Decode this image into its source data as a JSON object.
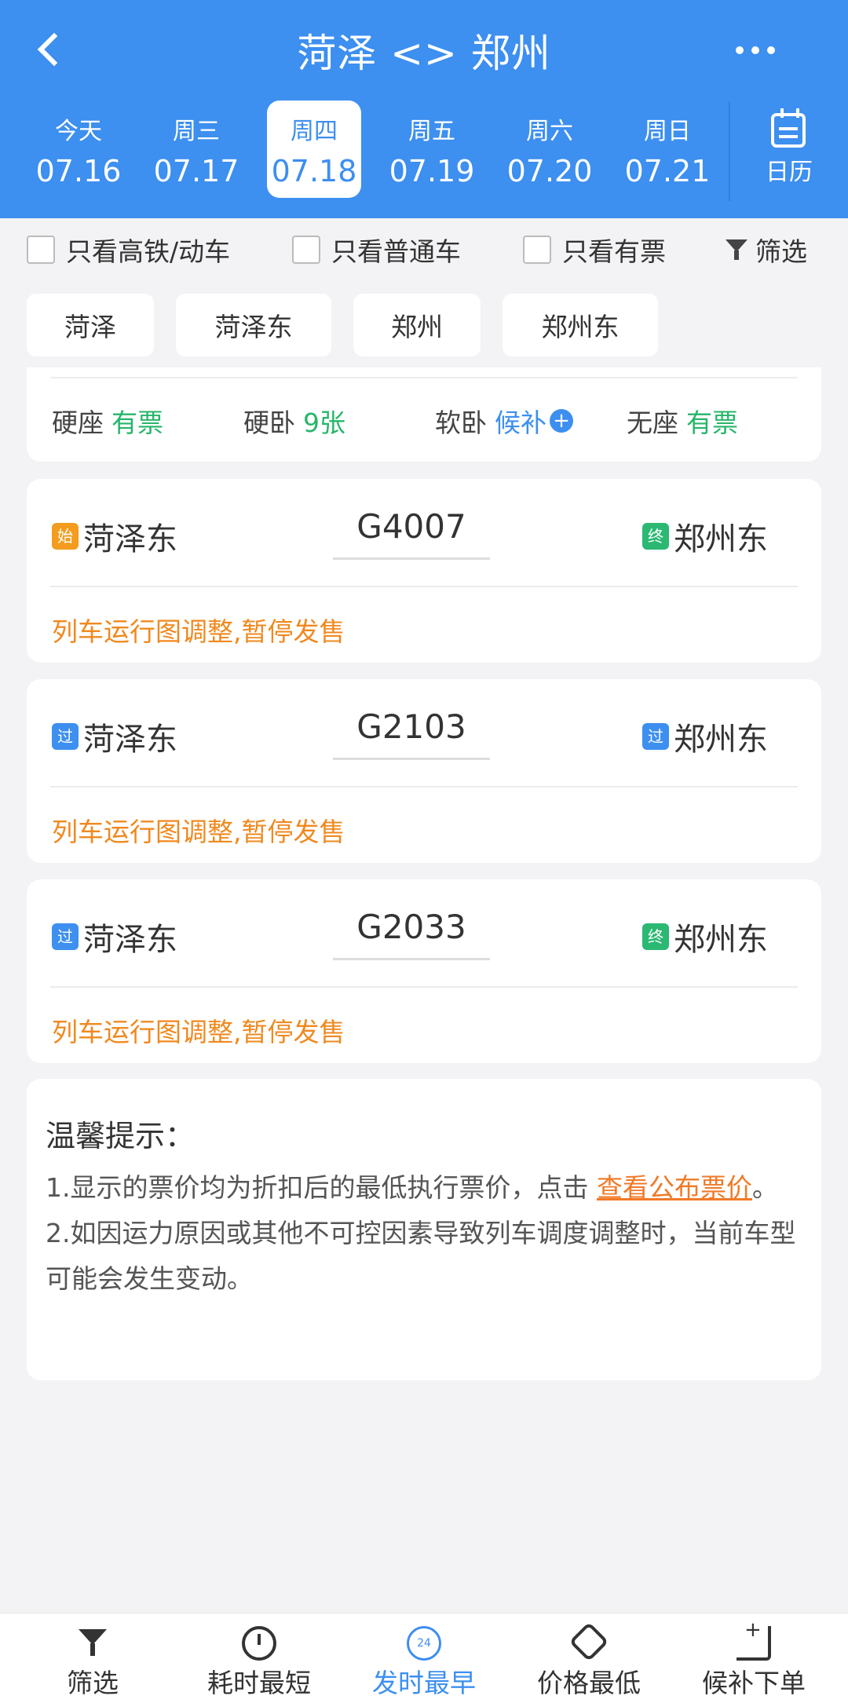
{
  "header": {
    "title": "菏泽 <> 郑州",
    "dates": [
      {
        "week": "今天",
        "date": "07.16"
      },
      {
        "week": "周三",
        "date": "07.17"
      },
      {
        "week": "周四",
        "date": "07.18"
      },
      {
        "week": "周五",
        "date": "07.19"
      },
      {
        "week": "周六",
        "date": "07.20"
      },
      {
        "week": "周日",
        "date": "07.21"
      }
    ],
    "calendar_label": "日历"
  },
  "filters": {
    "high_speed": "只看高铁/动车",
    "normal": "只看普通车",
    "available": "只看有票",
    "filter_label": "筛选"
  },
  "stations": [
    "菏泽",
    "菏泽东",
    "郑州",
    "郑州东"
  ],
  "seat_card": {
    "seats": [
      {
        "name": "硬座",
        "status": "有票"
      },
      {
        "name": "硬卧",
        "status": "9张"
      },
      {
        "name": "软卧",
        "status": "候补"
      },
      {
        "name": "无座",
        "status": "有票"
      }
    ]
  },
  "trains": [
    {
      "from_tag": "始",
      "from": "菏泽东",
      "number": "G4007",
      "to_tag": "终",
      "to": "郑州东",
      "notice": "列车运行图调整,暂停发售"
    },
    {
      "from_tag": "过",
      "from": "菏泽东",
      "number": "G2103",
      "to_tag": "过",
      "to": "郑州东",
      "notice": "列车运行图调整,暂停发售"
    },
    {
      "from_tag": "过",
      "from": "菏泽东",
      "number": "G2033",
      "to_tag": "终",
      "to": "郑州东",
      "notice": "列车运行图调整,暂停发售"
    }
  ],
  "tips": {
    "title": "温馨提示：",
    "line1_a": "1.显示的票价均为折扣后的最低执行票价，点击 ",
    "line1_link": "查看公布票价",
    "line1_end": "。",
    "line2": "2.如因运力原因或其他不可控因素导致列车调度调整时，当前车型可能会发生变动。"
  },
  "bottom_tabs": [
    {
      "label": "筛选",
      "icon": "filter-icon"
    },
    {
      "label": "耗时最短",
      "icon": "clock-icon"
    },
    {
      "label": "发时最早",
      "icon": "24-icon",
      "icon_text": "24"
    },
    {
      "label": "价格最低",
      "icon": "price-tag-icon"
    },
    {
      "label": "候补下单",
      "icon": "cart-icon"
    }
  ],
  "colors": {
    "primary": "#3d8ff0",
    "green": "#27b56a",
    "orange": "#f0891f"
  }
}
